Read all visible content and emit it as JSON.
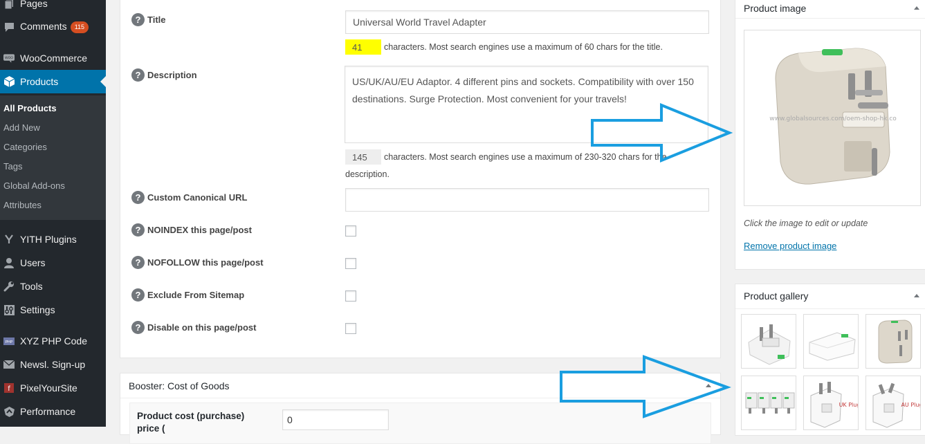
{
  "sidebar": {
    "items": [
      {
        "label": "Pages",
        "icon": "pages-icon"
      },
      {
        "label": "Comments",
        "icon": "comments-icon",
        "badge": "115"
      },
      {
        "label": "WooCommerce",
        "icon": "woocommerce-icon"
      },
      {
        "label": "Products",
        "icon": "products-icon",
        "current": true
      },
      {
        "label": "YITH Plugins",
        "icon": "yith-icon"
      },
      {
        "label": "Users",
        "icon": "users-icon"
      },
      {
        "label": "Tools",
        "icon": "tools-icon"
      },
      {
        "label": "Settings",
        "icon": "settings-icon"
      },
      {
        "label": "XYZ PHP Code",
        "icon": "php-icon"
      },
      {
        "label": "Newsl. Sign-up",
        "icon": "newsletter-icon"
      },
      {
        "label": "PixelYourSite",
        "icon": "pixelyoursite-icon"
      },
      {
        "label": "Performance",
        "icon": "performance-icon"
      }
    ],
    "submenu": [
      {
        "label": "All Products",
        "current": true
      },
      {
        "label": "Add New"
      },
      {
        "label": "Categories"
      },
      {
        "label": "Tags"
      },
      {
        "label": "Global Add-ons"
      },
      {
        "label": "Attributes"
      }
    ]
  },
  "seo": {
    "help_glyph": "?",
    "title_label": "Title",
    "title_value": "Universal World Travel Adapter",
    "title_count": "41",
    "title_hint": "characters. Most search engines use a maximum of 60 chars for the title.",
    "description_label": "Description",
    "description_value": "US/UK/AU/EU Adaptor.  4 different pins and sockets. Compatibility with over 150 destinations. Surge Protection. Most convenient for your travels!",
    "description_count": "145",
    "description_hint_1": "characters. Most search engines use a maximum of 230-320 chars for the",
    "description_hint_2": "description.",
    "canonical_label": "Custom Canonical URL",
    "canonical_value": "",
    "noindex_label": "NOINDEX this page/post",
    "nofollow_label": "NOFOLLOW this page/post",
    "sitemap_label": "Exclude From Sitemap",
    "disable_label": "Disable on this page/post"
  },
  "booster": {
    "title": "Booster: Cost of Goods",
    "cost_label": "Product cost (purchase)",
    "cost_label_2": "price (",
    "cost_value": "0"
  },
  "product_image": {
    "title": "Product image",
    "watermark": "www.globalsources.com/oem-shop-hk.co",
    "edit_hint": "Click the image to edit or update",
    "remove_label": "Remove product image"
  },
  "gallery": {
    "title": "Product gallery",
    "thumbs": [
      {
        "caption": ""
      },
      {
        "caption": ""
      },
      {
        "caption": ""
      },
      {
        "caption": ""
      },
      {
        "caption": "UK Plug"
      },
      {
        "caption": "AU Plug"
      }
    ]
  },
  "colors": {
    "sidebar_bg": "#23282d",
    "menu_current": "#0073aa",
    "counter_highlight": "#ffff00",
    "counter_plain": "#eeeeee",
    "annotation_arrow": "#1a9ee0"
  }
}
